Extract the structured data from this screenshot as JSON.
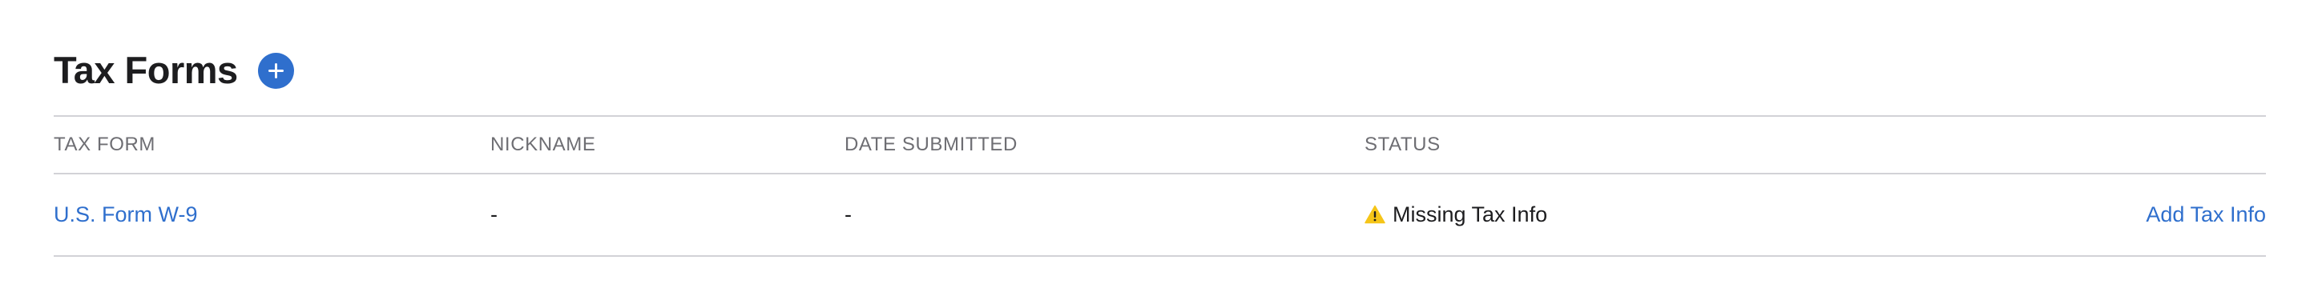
{
  "section": {
    "title": "Tax Forms",
    "add_icon": "plus-circle-icon"
  },
  "table": {
    "headers": [
      "TAX FORM",
      "NICKNAME",
      "DATE SUBMITTED",
      "STATUS"
    ],
    "rows": [
      {
        "tax_form": "U.S. Form W-9",
        "nickname": "-",
        "date_submitted": "-",
        "status": "Missing Tax Info",
        "status_icon": "warning-icon",
        "action": "Add Tax Info"
      }
    ]
  },
  "colors": {
    "accent": "#2f6fcd",
    "warning": "#f5c518",
    "divider": "#d2d2d7",
    "header_text": "#6e6e73"
  }
}
